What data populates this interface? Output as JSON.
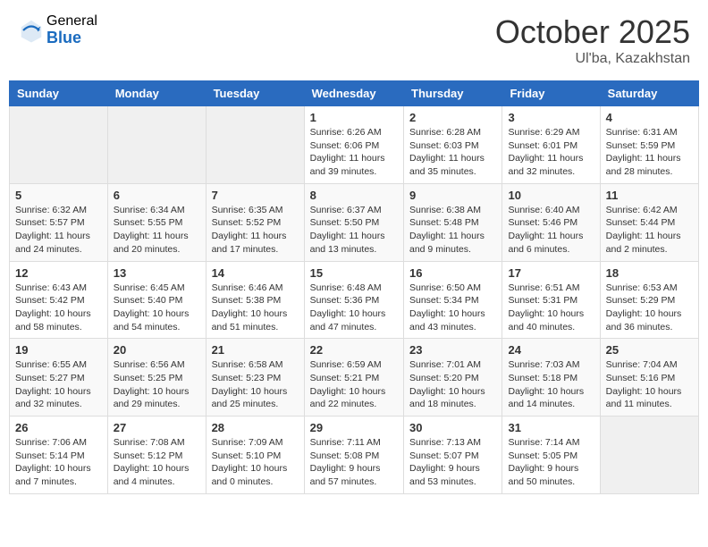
{
  "header": {
    "logo_general": "General",
    "logo_blue": "Blue",
    "month_title": "October 2025",
    "location": "Ul'ba, Kazakhstan"
  },
  "days_of_week": [
    "Sunday",
    "Monday",
    "Tuesday",
    "Wednesday",
    "Thursday",
    "Friday",
    "Saturday"
  ],
  "weeks": [
    [
      {
        "day": "",
        "info": ""
      },
      {
        "day": "",
        "info": ""
      },
      {
        "day": "",
        "info": ""
      },
      {
        "day": "1",
        "info": "Sunrise: 6:26 AM\nSunset: 6:06 PM\nDaylight: 11 hours and 39 minutes."
      },
      {
        "day": "2",
        "info": "Sunrise: 6:28 AM\nSunset: 6:03 PM\nDaylight: 11 hours and 35 minutes."
      },
      {
        "day": "3",
        "info": "Sunrise: 6:29 AM\nSunset: 6:01 PM\nDaylight: 11 hours and 32 minutes."
      },
      {
        "day": "4",
        "info": "Sunrise: 6:31 AM\nSunset: 5:59 PM\nDaylight: 11 hours and 28 minutes."
      }
    ],
    [
      {
        "day": "5",
        "info": "Sunrise: 6:32 AM\nSunset: 5:57 PM\nDaylight: 11 hours and 24 minutes."
      },
      {
        "day": "6",
        "info": "Sunrise: 6:34 AM\nSunset: 5:55 PM\nDaylight: 11 hours and 20 minutes."
      },
      {
        "day": "7",
        "info": "Sunrise: 6:35 AM\nSunset: 5:52 PM\nDaylight: 11 hours and 17 minutes."
      },
      {
        "day": "8",
        "info": "Sunrise: 6:37 AM\nSunset: 5:50 PM\nDaylight: 11 hours and 13 minutes."
      },
      {
        "day": "9",
        "info": "Sunrise: 6:38 AM\nSunset: 5:48 PM\nDaylight: 11 hours and 9 minutes."
      },
      {
        "day": "10",
        "info": "Sunrise: 6:40 AM\nSunset: 5:46 PM\nDaylight: 11 hours and 6 minutes."
      },
      {
        "day": "11",
        "info": "Sunrise: 6:42 AM\nSunset: 5:44 PM\nDaylight: 11 hours and 2 minutes."
      }
    ],
    [
      {
        "day": "12",
        "info": "Sunrise: 6:43 AM\nSunset: 5:42 PM\nDaylight: 10 hours and 58 minutes."
      },
      {
        "day": "13",
        "info": "Sunrise: 6:45 AM\nSunset: 5:40 PM\nDaylight: 10 hours and 54 minutes."
      },
      {
        "day": "14",
        "info": "Sunrise: 6:46 AM\nSunset: 5:38 PM\nDaylight: 10 hours and 51 minutes."
      },
      {
        "day": "15",
        "info": "Sunrise: 6:48 AM\nSunset: 5:36 PM\nDaylight: 10 hours and 47 minutes."
      },
      {
        "day": "16",
        "info": "Sunrise: 6:50 AM\nSunset: 5:34 PM\nDaylight: 10 hours and 43 minutes."
      },
      {
        "day": "17",
        "info": "Sunrise: 6:51 AM\nSunset: 5:31 PM\nDaylight: 10 hours and 40 minutes."
      },
      {
        "day": "18",
        "info": "Sunrise: 6:53 AM\nSunset: 5:29 PM\nDaylight: 10 hours and 36 minutes."
      }
    ],
    [
      {
        "day": "19",
        "info": "Sunrise: 6:55 AM\nSunset: 5:27 PM\nDaylight: 10 hours and 32 minutes."
      },
      {
        "day": "20",
        "info": "Sunrise: 6:56 AM\nSunset: 5:25 PM\nDaylight: 10 hours and 29 minutes."
      },
      {
        "day": "21",
        "info": "Sunrise: 6:58 AM\nSunset: 5:23 PM\nDaylight: 10 hours and 25 minutes."
      },
      {
        "day": "22",
        "info": "Sunrise: 6:59 AM\nSunset: 5:21 PM\nDaylight: 10 hours and 22 minutes."
      },
      {
        "day": "23",
        "info": "Sunrise: 7:01 AM\nSunset: 5:20 PM\nDaylight: 10 hours and 18 minutes."
      },
      {
        "day": "24",
        "info": "Sunrise: 7:03 AM\nSunset: 5:18 PM\nDaylight: 10 hours and 14 minutes."
      },
      {
        "day": "25",
        "info": "Sunrise: 7:04 AM\nSunset: 5:16 PM\nDaylight: 10 hours and 11 minutes."
      }
    ],
    [
      {
        "day": "26",
        "info": "Sunrise: 7:06 AM\nSunset: 5:14 PM\nDaylight: 10 hours and 7 minutes."
      },
      {
        "day": "27",
        "info": "Sunrise: 7:08 AM\nSunset: 5:12 PM\nDaylight: 10 hours and 4 minutes."
      },
      {
        "day": "28",
        "info": "Sunrise: 7:09 AM\nSunset: 5:10 PM\nDaylight: 10 hours and 0 minutes."
      },
      {
        "day": "29",
        "info": "Sunrise: 7:11 AM\nSunset: 5:08 PM\nDaylight: 9 hours and 57 minutes."
      },
      {
        "day": "30",
        "info": "Sunrise: 7:13 AM\nSunset: 5:07 PM\nDaylight: 9 hours and 53 minutes."
      },
      {
        "day": "31",
        "info": "Sunrise: 7:14 AM\nSunset: 5:05 PM\nDaylight: 9 hours and 50 minutes."
      },
      {
        "day": "",
        "info": ""
      }
    ]
  ]
}
